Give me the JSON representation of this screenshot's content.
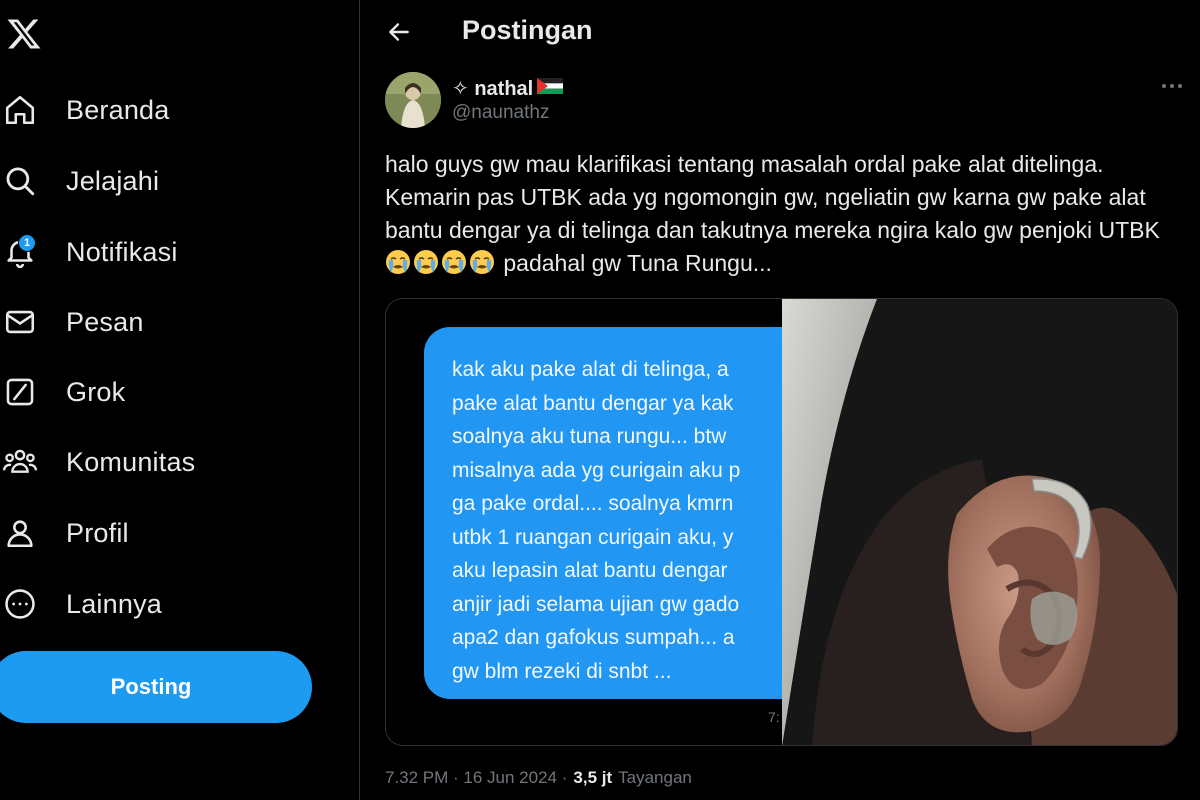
{
  "sidebar": {
    "logo_icon": "x-logo-icon",
    "items": [
      {
        "label": "Beranda",
        "icon": "home-icon"
      },
      {
        "label": "Jelajahi",
        "icon": "search-icon"
      },
      {
        "label": "Notifikasi",
        "icon": "bell-icon",
        "badge": "1"
      },
      {
        "label": "Pesan",
        "icon": "mail-icon"
      },
      {
        "label": "Grok",
        "icon": "grok-icon"
      },
      {
        "label": "Komunitas",
        "icon": "people-icon"
      },
      {
        "label": "Profil",
        "icon": "person-icon"
      },
      {
        "label": "Lainnya",
        "icon": "more-circle-icon"
      }
    ],
    "post_button": "Posting"
  },
  "header": {
    "title": "Postingan"
  },
  "tweet": {
    "display_name": "✧ nathal",
    "handle": "@naunathz",
    "text_part1": "halo guys gw mau klarifikasi tentang masalah ordal pake alat ditelinga. Kemarin pas UTBK ada yg ngomongin gw, ngeliatin gw karna gw pake alat bantu dengar ya di telinga dan takutnya mereka ngira kalo gw penjoki UTBK",
    "emoji_count": 4,
    "text_part2": " padahal gw Tuna Rungu...",
    "media": {
      "chat_lines": [
        "kak aku pake alat di telinga, a",
        "pake alat bantu dengar ya kak",
        "soalnya aku tuna rungu... btw",
        "misalnya ada yg curigain aku p",
        "ga pake ordal.... soalnya kmrn",
        "utbk 1 ruangan curigain aku, y",
        "aku lepasin alat bantu dengar",
        "anjir jadi selama ujian gw gado",
        "apa2 dan gafokus sumpah... a",
        "gw blm rezeki di snbt ..."
      ],
      "chat_time": "7:"
    },
    "timestamp": "7.32 PM · 16 Jun 2024 ·",
    "views_count": "3,5 jt",
    "views_label": "Tayangan"
  },
  "colors": {
    "background": "#000000",
    "accent": "#1d9bf0",
    "text": "#e7e9ea",
    "muted": "#71767b",
    "chat_bubble": "#2196f3"
  }
}
